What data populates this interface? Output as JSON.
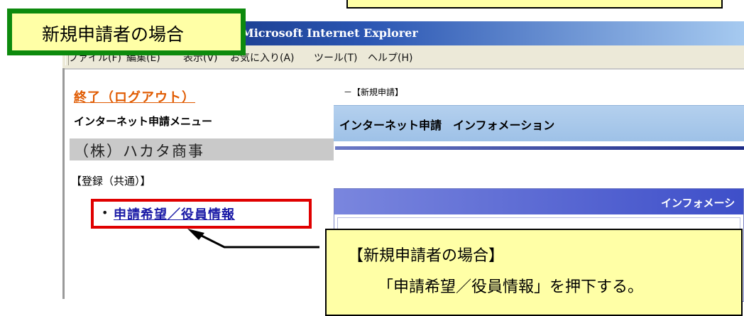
{
  "window": {
    "title": "Microsoft Internet Explorer"
  },
  "menubar": {
    "items": [
      "ファイル(F)",
      "編集(E)",
      "表示(V)",
      "お気に入り(A)",
      "ツール(T)",
      "ヘルプ(H)"
    ]
  },
  "left_pane": {
    "logout": "終了（ログアウト）",
    "menu_title": "インターネット申請メニュー",
    "company": "（株）ハカタ商事",
    "section": "【登録（共通）】",
    "link": "申請希望／役員情報",
    "bullet": "•"
  },
  "right_pane": {
    "breadcrumb": "－【新規申請】",
    "info_title": "インターネット申請　インフォメーション",
    "info_box_title": "インフォメーシ"
  },
  "annotations": {
    "label": "新規申請者の場合",
    "callout_line1": "【新規申請者の場合】",
    "callout_line2": "「申請希望／役員情報」を押下する。"
  },
  "colors": {
    "highlight": "#e00000",
    "label_border": "#0d8a0d",
    "callout_bg": "#ffffa6",
    "logout": "#e05a00",
    "link": "#1a1aa6"
  }
}
